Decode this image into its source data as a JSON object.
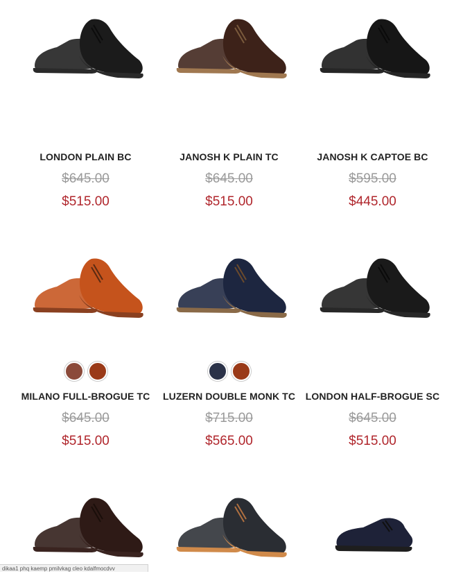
{
  "products": [
    {
      "name": "LONDON PLAIN BC",
      "old_price": "$645.00",
      "price": "$515.00",
      "image_label": "black plain derby shoe",
      "colors": {
        "upper": "#1b1b1b",
        "sole": "#0c0c0c",
        "welt": "#2a2a2a"
      },
      "swatches": []
    },
    {
      "name": "JANOSH K PLAIN TC",
      "old_price": "$645.00",
      "price": "$515.00",
      "image_label": "dark brown plain toe shoe",
      "colors": {
        "upper": "#3d2219",
        "sole": "#7a5a3c",
        "welt": "#a07850"
      },
      "swatches": []
    },
    {
      "name": "JANOSH K CAPTOE BC",
      "old_price": "$595.00",
      "price": "$445.00",
      "image_label": "black cap toe shoe",
      "colors": {
        "upper": "#161616",
        "sole": "#0a0a0a",
        "welt": "#262626"
      },
      "swatches": []
    },
    {
      "name": "MILANO FULL-BROGUE TC",
      "old_price": "$645.00",
      "price": "$515.00",
      "image_label": "cognac full brogue shoe",
      "colors": {
        "upper": "#c5531c",
        "sole": "#5a2a12",
        "welt": "#8a4020"
      },
      "swatches": [
        {
          "label": "brown",
          "color": "#8b4a3a"
        },
        {
          "label": "cognac",
          "color": "#9a3a18"
        }
      ]
    },
    {
      "name": "LUZERN DOUBLE MONK TC",
      "old_price": "$715.00",
      "price": "$565.00",
      "image_label": "navy double monk strap shoe",
      "colors": {
        "upper": "#1d2640",
        "sole": "#6b4a2c",
        "welt": "#8a6a48"
      },
      "swatches": [
        {
          "label": "navy",
          "color": "#2b3248"
        },
        {
          "label": "cognac",
          "color": "#9a3a18"
        }
      ]
    },
    {
      "name": "LONDON HALF-BROGUE SC",
      "old_price": "$645.00",
      "price": "$515.00",
      "image_label": "black half brogue shoe",
      "colors": {
        "upper": "#1a1a1a",
        "sole": "#0a0a0a",
        "welt": "#282828"
      },
      "swatches": []
    },
    {
      "name": "",
      "old_price": "",
      "price": "",
      "image_label": "dark brown wingtip shoe",
      "colors": {
        "upper": "#2e1a16",
        "sole": "#1a0e0a",
        "welt": "#3a2420"
      },
      "swatches": []
    },
    {
      "name": "",
      "old_price": "",
      "price": "",
      "image_label": "grey wingtip with crepe sole",
      "colors": {
        "upper": "#2a2d33",
        "sole": "#b07040",
        "welt": "#d08a4a"
      },
      "swatches": []
    },
    {
      "name": "",
      "old_price": "",
      "price": "",
      "image_label": "navy and white spectator shoe",
      "colors": {
        "upper": "#1e2238",
        "sole": "#101010",
        "welt": "#1e1e1e"
      },
      "swatches": []
    }
  ],
  "status_text": "dikaa1 phq kaemp pmilvkag cleo kdalfmocdvv"
}
